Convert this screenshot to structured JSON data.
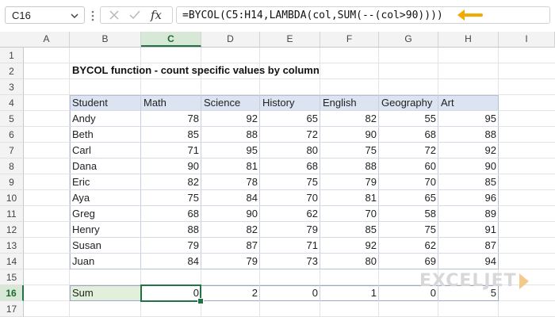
{
  "name_box": {
    "value": "C16"
  },
  "formula_bar": {
    "fx_label": "fx",
    "formula": "=BYCOL(C5:H14,LAMBDA(col,SUM(--(col>90))))"
  },
  "columns": [
    "A",
    "B",
    "C",
    "D",
    "E",
    "F",
    "G",
    "H",
    "I"
  ],
  "rows": [
    "1",
    "2",
    "3",
    "4",
    "5",
    "6",
    "7",
    "8",
    "9",
    "10",
    "11",
    "12",
    "13",
    "14",
    "15",
    "16",
    "17"
  ],
  "selected": {
    "column": "C",
    "row": "16"
  },
  "sheet": {
    "title": "BYCOL function - count specific values by column",
    "headers": [
      "Student",
      "Math",
      "Science",
      "History",
      "English",
      "Geography",
      "Art"
    ],
    "rows": [
      {
        "student": "Andy",
        "scores": [
          "78",
          "92",
          "65",
          "82",
          "55",
          "95"
        ]
      },
      {
        "student": "Beth",
        "scores": [
          "85",
          "88",
          "72",
          "90",
          "68",
          "88"
        ]
      },
      {
        "student": "Carl",
        "scores": [
          "71",
          "95",
          "80",
          "75",
          "72",
          "92"
        ]
      },
      {
        "student": "Dana",
        "scores": [
          "90",
          "81",
          "68",
          "88",
          "60",
          "90"
        ]
      },
      {
        "student": "Eric",
        "scores": [
          "82",
          "78",
          "75",
          "79",
          "70",
          "85"
        ]
      },
      {
        "student": "Aya",
        "scores": [
          "75",
          "84",
          "70",
          "81",
          "65",
          "96"
        ]
      },
      {
        "student": "Greg",
        "scores": [
          "68",
          "90",
          "62",
          "70",
          "58",
          "89"
        ]
      },
      {
        "student": "Henry",
        "scores": [
          "88",
          "82",
          "79",
          "85",
          "75",
          "91"
        ]
      },
      {
        "student": "Susan",
        "scores": [
          "79",
          "87",
          "71",
          "92",
          "62",
          "87"
        ]
      },
      {
        "student": "Juan",
        "scores": [
          "84",
          "79",
          "73",
          "80",
          "69",
          "94"
        ]
      }
    ],
    "sum_label": "Sum",
    "sum_values": [
      "0",
      "2",
      "0",
      "1",
      "0",
      "5"
    ]
  },
  "watermark": "EXCELJET",
  "colors": {
    "header_fill": "#dce3f1",
    "sum_label_fill": "#e2efda",
    "selection_green": "#217346",
    "annotation_arrow": "#f2a900"
  },
  "icons": [
    "chevron-down-icon",
    "more-options-icon",
    "cancel-x-icon",
    "enter-check-icon",
    "fx-icon",
    "arrow-annotation-icon",
    "corner-select-icon"
  ]
}
